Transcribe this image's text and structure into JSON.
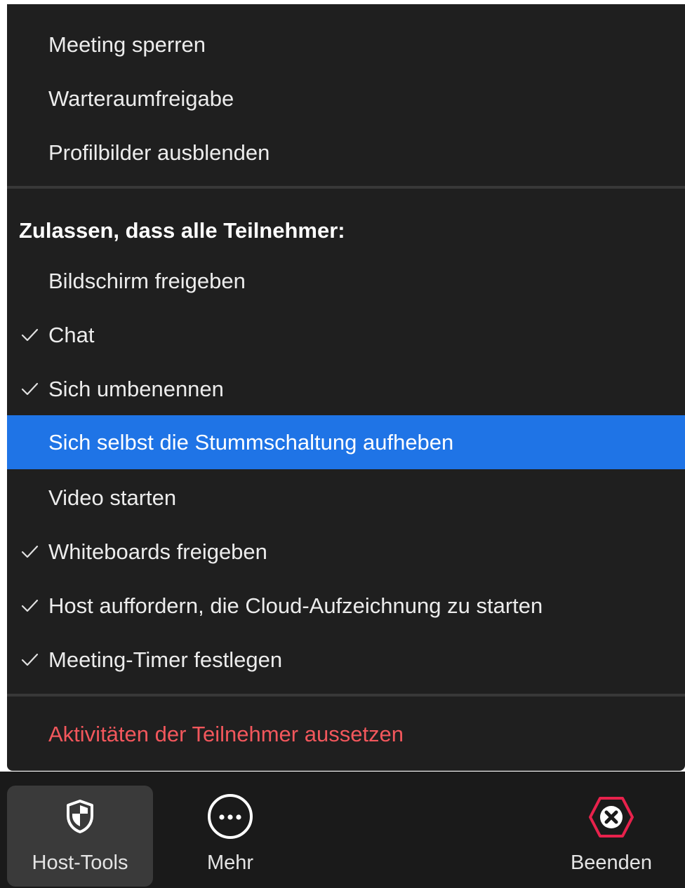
{
  "menu": {
    "items_top": [
      {
        "label": "Meeting sperren",
        "checked": false
      },
      {
        "label": "Warteraumfreigabe",
        "checked": false
      },
      {
        "label": "Profilbilder ausblenden",
        "checked": false
      }
    ],
    "section_heading": "Zulassen, dass alle Teilnehmer:",
    "items_participants": [
      {
        "label": "Bildschirm freigeben",
        "checked": false
      },
      {
        "label": "Chat",
        "checked": true
      },
      {
        "label": "Sich umbenennen",
        "checked": true
      },
      {
        "label": "Sich selbst die Stummschaltung aufheben",
        "checked": false,
        "highlighted": true
      },
      {
        "label": "Video starten",
        "checked": false
      },
      {
        "label": "Whiteboards freigeben",
        "checked": true
      },
      {
        "label": "Host auffordern, die Cloud-Aufzeichnung zu starten",
        "checked": true
      },
      {
        "label": "Meeting-Timer festlegen",
        "checked": true
      }
    ],
    "danger_item": {
      "label": "Aktivitäten der Teilnehmer aussetzen"
    }
  },
  "toolbar": {
    "host_tools": {
      "label": "Host-Tools",
      "icon": "shield-icon"
    },
    "more": {
      "label": "Mehr",
      "icon": "ellipsis-circle-icon"
    },
    "end": {
      "label": "Beenden",
      "icon": "close-hexagon-icon"
    }
  },
  "colors": {
    "menu_background": "#1f1f1f",
    "highlight": "#1f74e6",
    "danger": "#f2575c",
    "end_icon": "#e8224c"
  }
}
